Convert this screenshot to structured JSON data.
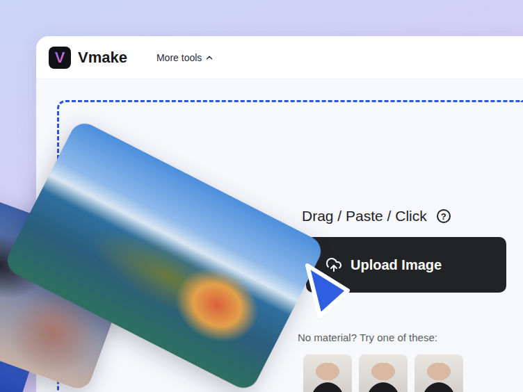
{
  "header": {
    "logo_mark": "V",
    "brand": "Vmake",
    "menu": {
      "label": "More tools",
      "expanded": true
    }
  },
  "upload": {
    "hint": "Drag / Paste / Click",
    "help_icon": "?",
    "button": "Upload Image"
  },
  "samples": {
    "label": "No material? Try one of these:",
    "items": [
      {
        "kind": "photo"
      },
      {
        "kind": "photo"
      },
      {
        "kind": "photo"
      }
    ]
  }
}
